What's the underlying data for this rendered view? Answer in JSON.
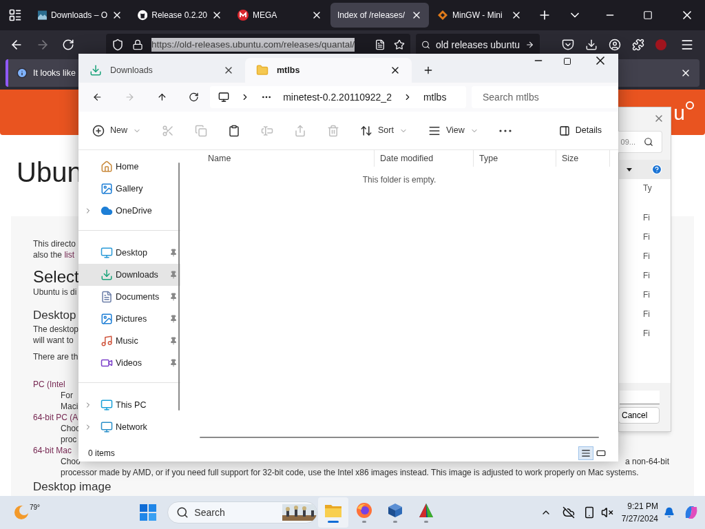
{
  "browser": {
    "tabs": [
      {
        "title": "Downloads – O",
        "selected": false,
        "kind": "picture"
      },
      {
        "title": "Release 0.2.20",
        "selected": false,
        "kind": "github"
      },
      {
        "title": "MEGA",
        "selected": false,
        "kind": "mega"
      },
      {
        "title": "Index of /releases/",
        "selected": true,
        "kind": "plain"
      },
      {
        "title": "MinGW - Mini",
        "selected": false,
        "kind": "diamond"
      }
    ],
    "url": "https://old-releases.ubuntu.com/releases/quantal/",
    "search": "old releases ubuntu",
    "notification": "It looks like"
  },
  "page": {
    "logo": "u",
    "lines": [
      {
        "kind": "h1",
        "text": "Ubun"
      },
      {
        "kind": "p",
        "text": "This directo"
      },
      {
        "kind": "p",
        "text": "also the ",
        "link": "list"
      },
      {
        "kind": "h2",
        "text": "Select"
      },
      {
        "kind": "p",
        "text": "Ubuntu is di"
      },
      {
        "kind": "h3",
        "text": "Desktop"
      },
      {
        "kind": "p",
        "text": "The desktop"
      },
      {
        "kind": "p",
        "text": "will want to"
      },
      {
        "kind": "p",
        "text": "There are th"
      },
      {
        "kind": "term",
        "text": "PC (Intel"
      },
      {
        "kind": "indent",
        "text": "For"
      },
      {
        "kind": "indent",
        "text": "Maci"
      },
      {
        "kind": "term",
        "text": "64-bit PC (A"
      },
      {
        "kind": "indent",
        "text": "Choo"
      },
      {
        "kind": "indent",
        "text": "proc"
      },
      {
        "kind": "term",
        "text": "64-bit Mac"
      },
      {
        "kind": "split",
        "text": "Choo",
        "right": "a non-64-bit"
      },
      {
        "kind": "indent",
        "text": "processor made by AMD, or if you need full support for 32-bit code, use the Intel x86 images instead. This image is adjusted to work properly on Mac systems."
      },
      {
        "kind": "h3",
        "text": "Desktop image"
      }
    ]
  },
  "dialog": {
    "search": "09...",
    "column": "Ty",
    "rows": [
      "Fi",
      "Fi",
      "Fi",
      "Fi",
      "Fi",
      "Fi",
      "Fi"
    ],
    "cancel": "Cancel"
  },
  "explorer": {
    "tabs": [
      {
        "label": "Downloads",
        "selected": false,
        "kind": "download"
      },
      {
        "label": "mtlbs",
        "selected": true,
        "kind": "folder"
      }
    ],
    "path": [
      "minetest-0.2.20110922_2",
      "mtlbs"
    ],
    "search_placeholder": "Search mtlbs",
    "toolbar": [
      {
        "kind": "new",
        "label": "New",
        "disabled": false
      },
      {
        "kind": "cut",
        "disabled": true
      },
      {
        "kind": "copy",
        "disabled": true
      },
      {
        "kind": "paste",
        "disabled": false
      },
      {
        "kind": "rename",
        "disabled": true
      },
      {
        "kind": "share",
        "disabled": true
      },
      {
        "kind": "delete",
        "disabled": true
      },
      {
        "kind": "sort",
        "label": "Sort",
        "disabled": false
      },
      {
        "kind": "view",
        "label": "View",
        "disabled": false
      },
      {
        "kind": "more",
        "disabled": false
      }
    ],
    "details": "Details",
    "columns": [
      "Name",
      "Date modified",
      "Type",
      "Size"
    ],
    "empty": "This folder is empty.",
    "sidebar": [
      [
        {
          "label": "Home",
          "kind": "home",
          "expandable": false,
          "pinned": false,
          "selected": false
        },
        {
          "label": "Gallery",
          "kind": "gallery",
          "expandable": false,
          "pinned": false,
          "selected": false
        },
        {
          "label": "OneDrive",
          "kind": "cloud",
          "expandable": true,
          "pinned": false,
          "selected": false
        }
      ],
      [
        {
          "label": "Desktop",
          "kind": "desktop",
          "expandable": false,
          "pinned": true,
          "selected": false
        },
        {
          "label": "Downloads",
          "kind": "download",
          "expandable": false,
          "pinned": true,
          "selected": true
        },
        {
          "label": "Documents",
          "kind": "documents",
          "expandable": false,
          "pinned": true,
          "selected": false
        },
        {
          "label": "Pictures",
          "kind": "pictures",
          "expandable": false,
          "pinned": true,
          "selected": false
        },
        {
          "label": "Music",
          "kind": "music",
          "expandable": false,
          "pinned": true,
          "selected": false
        },
        {
          "label": "Videos",
          "kind": "videos",
          "expandable": false,
          "pinned": true,
          "selected": false
        }
      ],
      [
        {
          "label": "This PC",
          "kind": "pc",
          "expandable": true,
          "pinned": false,
          "selected": false
        },
        {
          "label": "Network",
          "kind": "network",
          "expandable": true,
          "pinned": false,
          "selected": false
        }
      ]
    ],
    "status": "0 items",
    "views": [
      {
        "kind": "details",
        "selected": true
      },
      {
        "kind": "tiles",
        "selected": false
      }
    ]
  },
  "taskbar": {
    "temperature": "79°",
    "search": "Search",
    "apps": [
      {
        "kind": "explorer",
        "active": true
      },
      {
        "kind": "firefox",
        "active": false
      },
      {
        "kind": "virtualbox",
        "active": false
      },
      {
        "kind": "cmake",
        "active": false
      }
    ],
    "time": "9:21 PM",
    "date": "7/27/2024"
  }
}
